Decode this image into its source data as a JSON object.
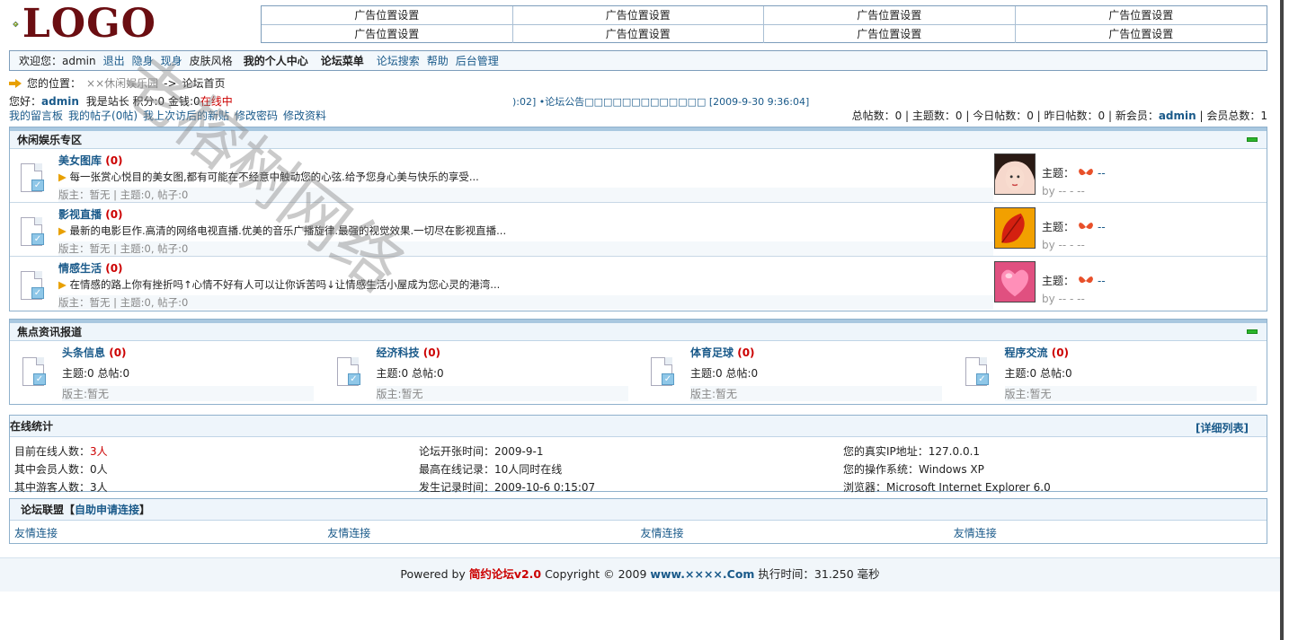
{
  "logo": {
    "text": "LOGO"
  },
  "ads": [
    "广告位置设置",
    "广告位置设置",
    "广告位置设置",
    "广告位置设置",
    "广告位置设置",
    "广告位置设置",
    "广告位置设置",
    "广告位置设置"
  ],
  "nav": {
    "welcome": "欢迎您：",
    "user": "admin",
    "items": [
      "退出",
      "隐身",
      "现身"
    ],
    "skin": "皮肤风格",
    "center": "我的个人中心",
    "menu": "论坛菜单",
    "links": [
      "论坛搜索",
      "帮助",
      "后台管理"
    ]
  },
  "breadcrumb": {
    "label": "您的位置：",
    "home": "××休闲娱乐园",
    "sep": "->",
    "current": "论坛首页"
  },
  "hello": {
    "prefix": "您好：",
    "user": "admin",
    "info": "我是站长  积分:0  金钱:0",
    "status": "在线中"
  },
  "notice": "):02]  •论坛公告□□□□□□□□□□□□□ [2009-9-30 9:36:04]",
  "mylinks": [
    "我的留言板",
    "我的帖子(0帖)",
    "我上次访后的新贴",
    "修改密码",
    "修改资料"
  ],
  "stats": {
    "text1": "总帖数：0 | 主题数：0 | 今日帖数：0 | 昨日帖数：0 | 新会员：",
    "member": "admin",
    "text2": " | 会员总数：1"
  },
  "section1": {
    "title": "休闲娱乐专区",
    "forums": [
      {
        "name": "美女图库",
        "count": "(0)",
        "desc": "每一张赏心悦目的美女图,都有可能在不经意中触动您的心弦.给予您身心美与快乐的享受...",
        "mod": "版主：暂无  | 主题:0, 帖子:0",
        "topic_label": "主题：",
        "topic_val": "--",
        "by": "by -- - --"
      },
      {
        "name": "影视直播",
        "count": "(0)",
        "desc": "最新的电影巨作.高清的网络电视直播.优美的音乐广播旋律.最强的视觉效果.一切尽在影视直播...",
        "mod": "版主：暂无  | 主题:0, 帖子:0",
        "topic_label": "主题：",
        "topic_val": "--",
        "by": "by -- - --"
      },
      {
        "name": "情感生活",
        "count": "(0)",
        "desc": "在情感的路上你有挫折吗↑心情不好有人可以让你诉苦吗↓让情感生活小屋成为您心灵的港湾...",
        "mod": "版主：暂无  | 主题:0, 帖子:0",
        "topic_label": "主题：",
        "topic_val": "--",
        "by": "by -- - --"
      }
    ]
  },
  "section2": {
    "title": "焦点资讯报道",
    "forums": [
      {
        "name": "头条信息",
        "count": "(0)",
        "stats": "主题:0 总帖:0",
        "mod": "版主:暂无"
      },
      {
        "name": "经济科技",
        "count": "(0)",
        "stats": "主题:0 总帖:0",
        "mod": "版主:暂无"
      },
      {
        "name": "体育足球",
        "count": "(0)",
        "stats": "主题:0 总帖:0",
        "mod": "版主:暂无"
      },
      {
        "name": "程序交流",
        "count": "(0)",
        "stats": "主题:0 总帖:0",
        "mod": "版主:暂无"
      }
    ]
  },
  "online": {
    "title": "在线统计",
    "detail": "[详细列表]",
    "col1": {
      "l1": "目前在线人数：",
      "v1": "3人",
      "l2": "其中会员人数：0人",
      "l3": "其中游客人数：3人"
    },
    "col2": {
      "l1": "论坛开张时间：2009-9-1",
      "l2": "最高在线记录：10人同时在线",
      "l3": "发生记录时间：2009-10-6 0:15:07"
    },
    "col3": {
      "l1": "您的真实IP地址：127.0.0.1",
      "l2": "您的操作系统：Windows XP",
      "l3": "浏览器：Microsoft Internet Explorer 6.0"
    }
  },
  "links": {
    "title": "论坛联盟【",
    "apply": "自助申请连接",
    "title_end": "】",
    "items": [
      "友情连接",
      "友情连接",
      "友情连接",
      "友情连接"
    ]
  },
  "footer": {
    "pre": "Powered by ",
    "brand": "简约论坛v2.0",
    "mid": " Copyright © 2009 ",
    "site": "www.××××.Com",
    "post": " 执行时间：31.250 毫秒"
  },
  "watermark": "老榕树网络",
  "colors": {
    "accent": "#1a5a8a",
    "border": "#8fb1cc",
    "red": "#cc0000",
    "logo": "#6b0e12"
  }
}
